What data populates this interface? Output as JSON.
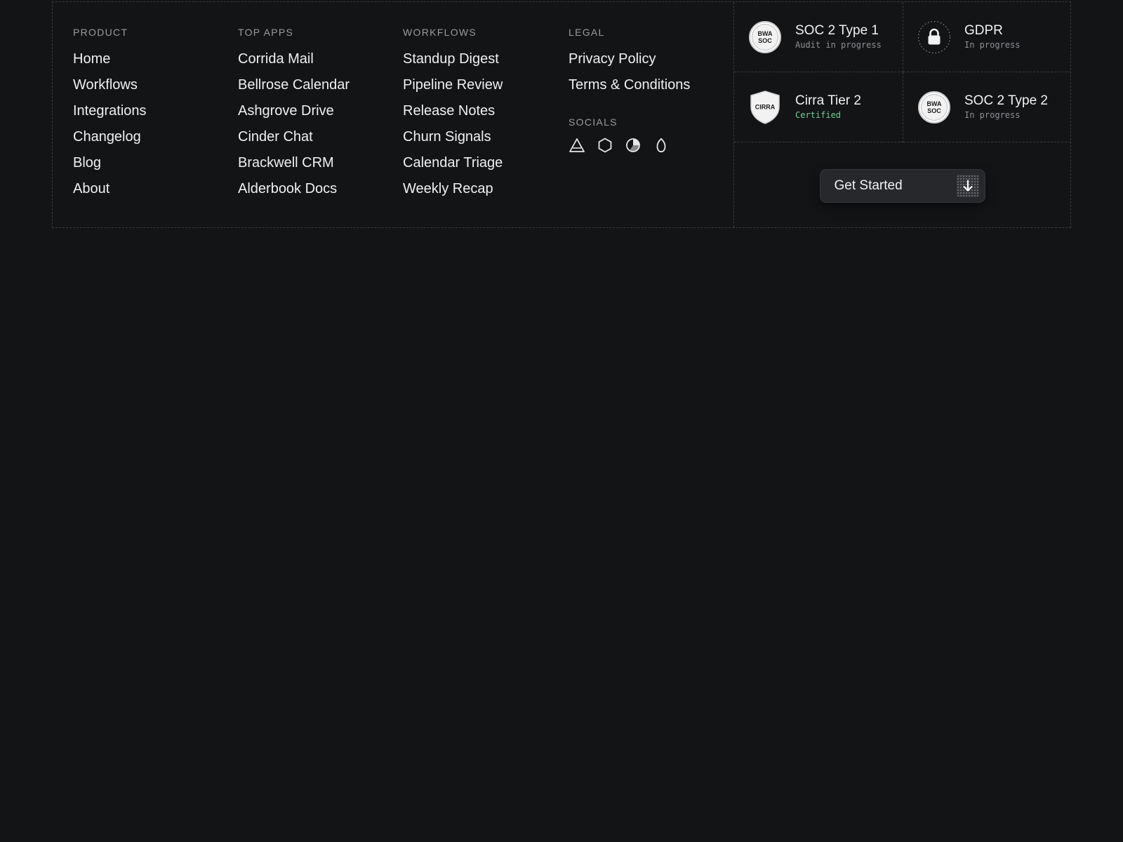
{
  "columns": [
    {
      "heading": "PRODUCT",
      "items": [
        "Home",
        "Workflows",
        "Integrations",
        "Changelog",
        "Blog",
        "About"
      ]
    },
    {
      "heading": "TOP APPS",
      "items": [
        "Corrida Mail",
        "Bellrose Calendar",
        "Ashgrove Drive",
        "Cinder Chat",
        "Brackwell CRM",
        "Alderbook Docs"
      ]
    },
    {
      "heading": "WORKFLOWS",
      "items": [
        "Standup Digest",
        "Pipeline Review",
        "Release Notes",
        "Churn Signals",
        "Calendar Triage",
        "Weekly Recap"
      ]
    },
    {
      "heading": "LEGAL",
      "items": [
        "Privacy Policy",
        "Terms & Conditions"
      ]
    }
  ],
  "socials": {
    "heading": "SOCIALS",
    "icons": [
      "triangle-logo-icon",
      "hexagon-logo-icon",
      "pie-logo-icon",
      "drop-logo-icon"
    ]
  },
  "certifications": [
    {
      "title": "SOC 2 Type 1",
      "status": "Audit in progress",
      "badge_line1": "BWA",
      "badge_line2": "SOC"
    },
    {
      "title": "GDPR",
      "status": "In progress",
      "badge_icon": "lock-icon"
    },
    {
      "title": "Cirra Tier 2",
      "status": "Certified",
      "badge_text": "CIRRA",
      "status_color": "#6fcf97"
    },
    {
      "title": "SOC 2 Type 2",
      "status": "In progress",
      "badge_line1": "BWA",
      "badge_line2": "SOC"
    }
  ],
  "cta": {
    "label": "Get Started",
    "icon": "arrow-down-icon"
  },
  "colors": {
    "background": "#131416",
    "border": "#3a3b3e",
    "text": "#f0f0f0",
    "muted": "#9a9b9e",
    "success": "#6fcf97"
  }
}
